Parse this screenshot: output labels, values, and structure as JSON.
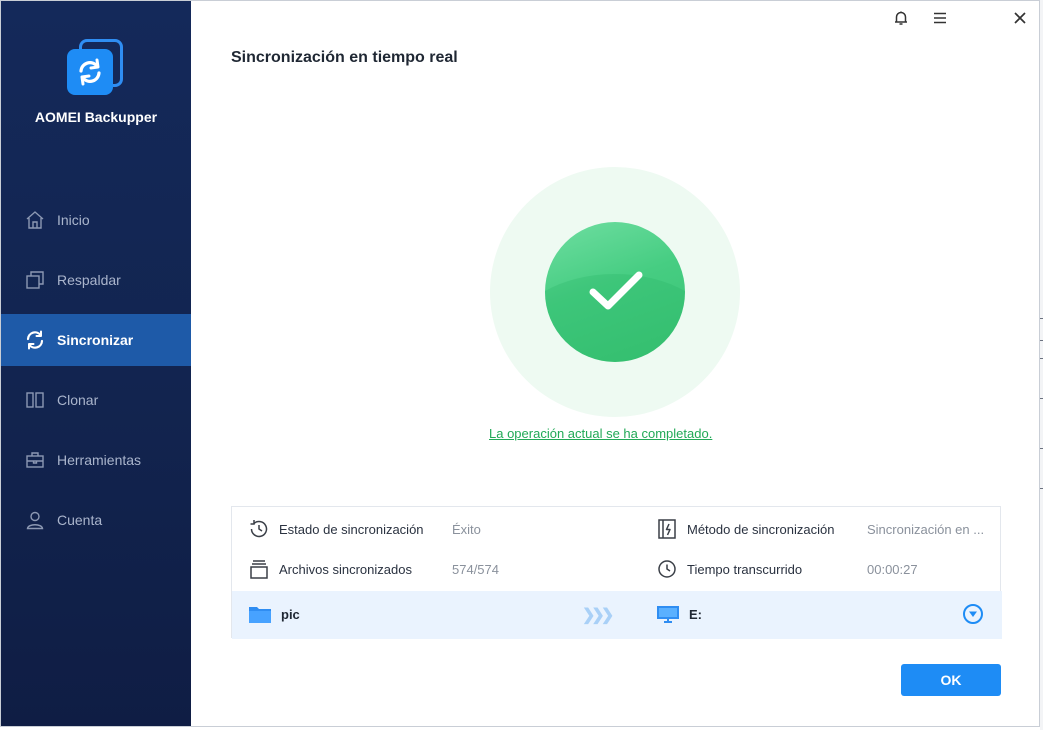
{
  "app": {
    "name": "AOMEI Backupper"
  },
  "sidebar": {
    "items": [
      {
        "label": "Inicio",
        "icon": "home-icon",
        "active": false
      },
      {
        "label": "Respaldar",
        "icon": "backup-icon",
        "active": false
      },
      {
        "label": "Sincronizar",
        "icon": "sync-icon",
        "active": true
      },
      {
        "label": "Clonar",
        "icon": "clone-icon",
        "active": false
      },
      {
        "label": "Herramientas",
        "icon": "toolbox-icon",
        "active": false
      },
      {
        "label": "Cuenta",
        "icon": "user-icon",
        "active": false
      }
    ]
  },
  "titlebar": {
    "icons": [
      "bell-icon",
      "menu-icon",
      "close-icon"
    ]
  },
  "page": {
    "title": "Sincronización en tiempo real",
    "status_message": "La operación actual se ha completado."
  },
  "details": {
    "sync_status": {
      "label": "Estado de sincronización",
      "value": "Éxito"
    },
    "sync_method": {
      "label": "Método de sincronización",
      "value": "Sincronización en ..."
    },
    "files_synced": {
      "label": "Archivos sincronizados",
      "value": "574/574"
    },
    "elapsed": {
      "label": "Tiempo transcurrido",
      "value": "00:00:27"
    }
  },
  "route": {
    "source": "pic",
    "destination": "E:"
  },
  "actions": {
    "ok_label": "OK"
  },
  "colors": {
    "sidebar": "#14295a",
    "accent": "#1e8cf5",
    "success": "#46cd82",
    "link": "#22a957"
  }
}
